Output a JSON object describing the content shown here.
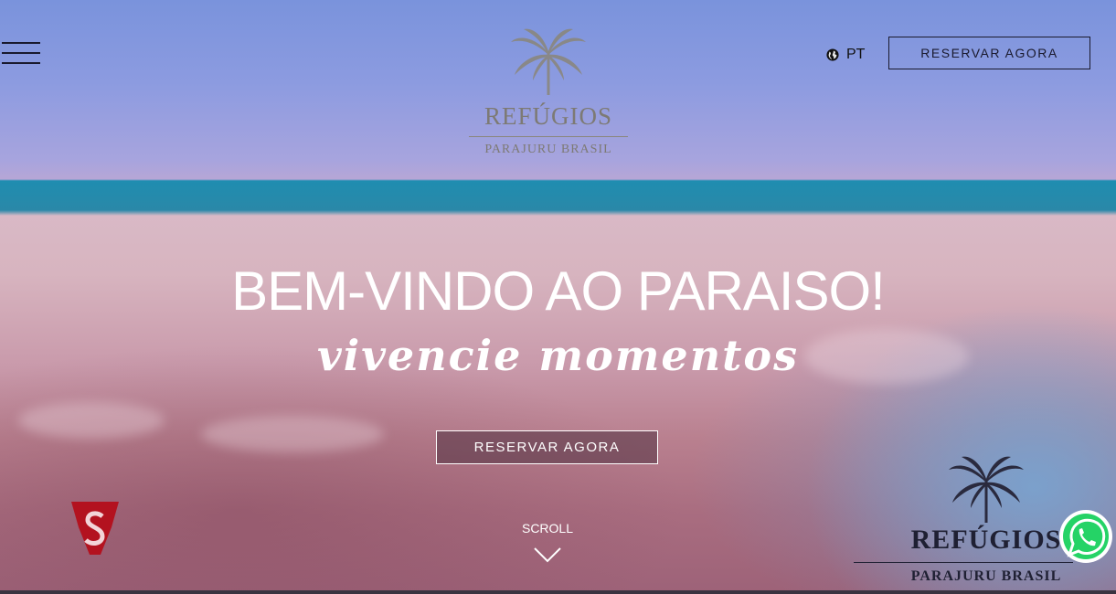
{
  "header": {
    "menu_icon": "hamburger-icon",
    "language": {
      "icon": "globe-icon",
      "label": "PT"
    },
    "cta_label": "RESERVAR AGORA"
  },
  "logo": {
    "icon": "palm-tree-icon",
    "name": "REFÚGIOS",
    "subtitle": "PARAJURU BRASIL"
  },
  "hero": {
    "headline": "BEM-VINDO AO PARAISO!",
    "subline": "vivencie momentos",
    "cta_label": "RESERVAR AGORA",
    "scroll_label": "SCROLL",
    "scroll_icon": "chevron-down-icon"
  },
  "watermark": {
    "icon": "palm-tree-icon",
    "name": "REFÚGIOS",
    "subtitle": "PARAJURU BRASIL"
  },
  "badges": {
    "s_badge_icon": "s-shield-icon",
    "whatsapp_icon": "whatsapp-icon"
  },
  "colors": {
    "dark_text": "#1a1a2e",
    "logo_gray": "#7d7a74",
    "white": "#ffffff",
    "whatsapp_green": "#25d366",
    "badge_red": "#b3121f"
  }
}
